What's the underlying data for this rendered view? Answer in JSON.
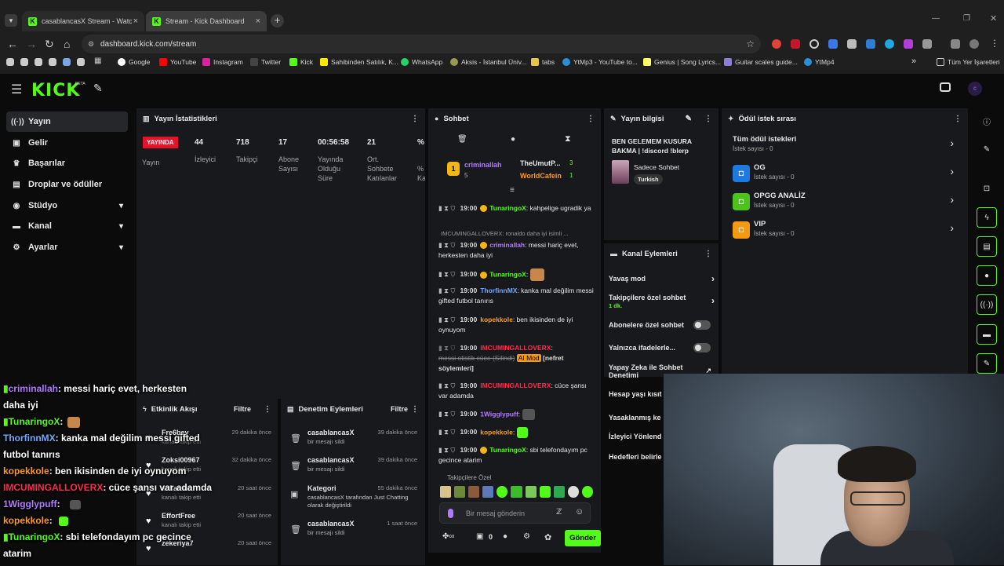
{
  "browser": {
    "tabs": [
      {
        "title": "casablancasX Stream - Watch L",
        "close": "×"
      },
      {
        "title": "Stream - Kick Dashboard",
        "close": "×"
      }
    ],
    "new_tab": "+",
    "url": "dashboard.kick.com/stream",
    "bookmarks": [
      "Google",
      "YouTube",
      "Instagram",
      "Twitter",
      "Kick",
      "Sahibinden Satılık, K...",
      "WhatsApp",
      "Aksis - İstanbul Üniv...",
      "tabs",
      "YtMp3 - YouTube to...",
      "Genius | Song Lyrics...",
      "Guitar scales guide...",
      "YtMp4",
      "Tüm Yer İşaretleri"
    ],
    "more": "»"
  },
  "app": {
    "logo": "KICK",
    "logo_beta": "BETA"
  },
  "sidebar": {
    "items": [
      {
        "label": "Yayın",
        "icon": "broadcast-icon"
      },
      {
        "label": "Gelir",
        "icon": "revenue-icon"
      },
      {
        "label": "Başarılar",
        "icon": "trophy-icon"
      },
      {
        "label": "Droplar ve ödüller",
        "icon": "gift-icon"
      },
      {
        "label": "Stüdyo",
        "icon": "studio-icon"
      },
      {
        "label": "Kanal",
        "icon": "channel-icon"
      },
      {
        "label": "Ayarlar",
        "icon": "settings-icon"
      }
    ]
  },
  "stats": {
    "title": "Yayın İstatistikleri",
    "live_badge": "YAYINDA",
    "live_label": "Yayın",
    "items": [
      {
        "value": "44",
        "label": "İzleyici"
      },
      {
        "value": "718",
        "label": "Takipçi"
      },
      {
        "value": "17",
        "label": "Abone Sayısı"
      },
      {
        "value": "00:56:58",
        "label": "Yayında Olduğu Süre"
      },
      {
        "value": "21",
        "label": "Ort. Sohbete Katılanlar"
      },
      {
        "value": "%",
        "label": "% Ka"
      }
    ]
  },
  "chat": {
    "title": "Sohbet",
    "top_users": [
      {
        "name": "criminallah",
        "count": "5"
      },
      {
        "name": "TheUmutP...",
        "count": "3"
      },
      {
        "name": "WorldCafein",
        "count": "1"
      }
    ],
    "reply_note": "IMCUMINGALLOVERX: ronaldo daha iyi isimli ...",
    "messages": [
      {
        "time": "19:00",
        "user": "TunaringoX",
        "text": ": kahpelige ugradik ya"
      },
      {
        "time": "19:00",
        "user": "criminallah",
        "text": ": messi hariç evet, herkesten daha iyi"
      },
      {
        "time": "19:00",
        "user": "TunaringoX",
        "text": ":"
      },
      {
        "time": "19:00",
        "user": "ThorfinnMX",
        "text": ": kanka mal değilim messi gifted futbol tanırıs"
      },
      {
        "time": "19:00",
        "user": "kopekkole",
        "text": ": ben ikisinden de iyi oynuyom"
      },
      {
        "time": "19:00",
        "user": "IMCUMINGALLOVERX",
        "text": ":",
        "deleted": "messi otistik cüce (Silindi)",
        "ai": "AI Mod",
        "reason": "[nefret söylemleri]"
      },
      {
        "time": "19:00",
        "user": "IMCUMINGALLOVERX",
        "text": ": cüce şansı var adamda"
      },
      {
        "time": "19:00",
        "user": "1Wigglypuff",
        "text": ":"
      },
      {
        "time": "19:00",
        "user": "kopekkole",
        "text": ":"
      },
      {
        "time": "19:00",
        "user": "TunaringoX",
        "text": ": sbi telefondayım pc gecince atarim"
      }
    ],
    "followers_only": "Takipçilere Özel",
    "input_placeholder": "Bir mesaj gönderin",
    "counter": "0",
    "send": "Gönder"
  },
  "stream_info": {
    "title": "Yayın bilgisi",
    "stream_title": "BEN GELEMEM KUSURA BAKMA | !discord !blerp",
    "category": "Sadece Sohbet",
    "tag": "Turkish"
  },
  "channel_actions": {
    "title": "Kanal Eylemleri",
    "items": [
      {
        "label": "Yavaş mod"
      },
      {
        "label": "Takipçilere özel sohbet",
        "sub": "1 dk."
      },
      {
        "label": "Abonelere özel sohbet"
      },
      {
        "label": "Yalnızca ifadelerle..."
      },
      {
        "label": "Yapay Zeka ile Sohbet Denetimi"
      },
      {
        "label": "Hesap yaşı kısıt"
      },
      {
        "label": "Yasaklanmış ke"
      },
      {
        "label": "İzleyici Yönlend"
      },
      {
        "label": "Hedefleri belirle"
      }
    ]
  },
  "rewards": {
    "title": "Ödül istek sırası",
    "all": {
      "name": "Tüm ödül istekleri",
      "count": "İstek sayısı - 0"
    },
    "items": [
      {
        "name": "OG",
        "count": "İstek sayısı - 0",
        "color": "#1f7ae0"
      },
      {
        "name": "OPGG ANALİZ",
        "count": "İstek sayısı - 0",
        "color": "#4cc21a"
      },
      {
        "name": "VIP",
        "count": "İstek sayısı - 0",
        "color": "#f39a12"
      }
    ]
  },
  "activity": {
    "title": "Etkinlik Akışı",
    "filter": "Filtre",
    "items": [
      {
        "name": "Fre6bey",
        "desc": "kanalı takip etti",
        "time": "29 dakika önce"
      },
      {
        "name": "Zoksi00967",
        "desc": "kanalı takip etti",
        "time": "32 dakika önce"
      },
      {
        "name": "sakaralar",
        "desc": "kanalı takip etti",
        "time": "20 saat önce"
      },
      {
        "name": "EffortFree",
        "desc": "kanalı takip etti",
        "time": "20 saat önce"
      },
      {
        "name": "zekeriya7",
        "desc": "",
        "time": "20 saat önce"
      }
    ]
  },
  "moderation": {
    "title": "Denetim Eylemleri",
    "filter": "Filtre",
    "items": [
      {
        "name": "casablancasX",
        "desc": "bir mesajı sildi",
        "time": "39 dakika önce"
      },
      {
        "name": "casablancasX",
        "desc": "bir mesajı sildi",
        "time": "39 dakika önce"
      },
      {
        "name": "Kategori",
        "desc": "casablancasX tarafından Just Chatting olarak değiştirildi",
        "time": "55 dakika önce"
      },
      {
        "name": "casablancasX",
        "desc": "bir mesajı sildi",
        "time": "1 saat önce"
      }
    ]
  },
  "overlay_chat": [
    {
      "user": "criminallah",
      "text": ":  messi hariç evet, herkesten",
      "color": "#b27bff"
    },
    {
      "user": "",
      "text": "daha iyi",
      "color": "#ffffff"
    },
    {
      "user": "TunaringoX",
      "text": ":",
      "color": "#53fc18"
    },
    {
      "user": "ThorfinnMX",
      "text": ":  kanka mal değilim messi gifted",
      "color": "#6fa8ff"
    },
    {
      "user": "",
      "text": "futbol tanırıs",
      "color": "#ffffff"
    },
    {
      "user": "kopekkole",
      "text": ":  ben ikisinden de iyi oynuyom",
      "color": "#ff9a1f"
    },
    {
      "user": "IMCUMINGALLOVERX",
      "text": ":  cüce şansı var adamda",
      "color": "#ff2a4d"
    },
    {
      "user": "1Wigglypuff",
      "text": ":",
      "color": "#b27bff"
    },
    {
      "user": "kopekkole",
      "text": ":",
      "color": "#ff9a1f"
    },
    {
      "user": "TunaringoX",
      "text": ":  sbi telefondayım pc gecince",
      "color": "#53fc18"
    },
    {
      "user": "",
      "text": "atarim",
      "color": "#ffffff"
    }
  ],
  "colors": {
    "accent": "#53fc18",
    "live": "#e5132a"
  }
}
